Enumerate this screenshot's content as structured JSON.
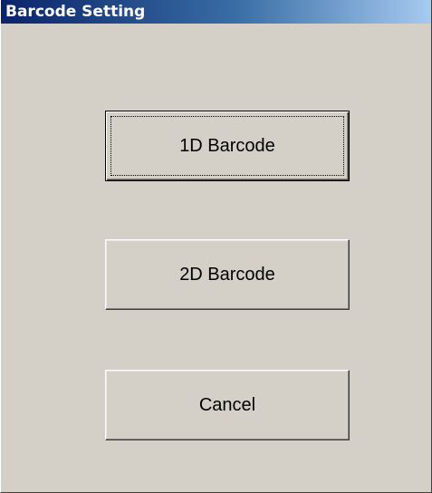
{
  "window": {
    "title": "Barcode Setting"
  },
  "buttons": {
    "barcode_1d_label": "1D Barcode",
    "barcode_2d_label": "2D Barcode",
    "cancel_label": "Cancel"
  },
  "colors": {
    "face": "#d4d0c8",
    "title_start": "#0a246a",
    "title_end": "#a6caf0",
    "title_text": "#ffffff"
  }
}
